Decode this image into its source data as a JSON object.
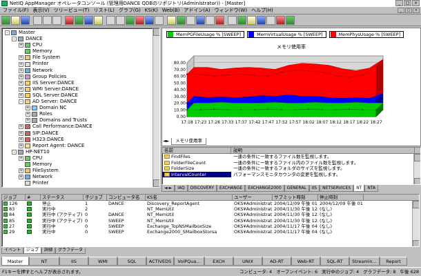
{
  "window": {
    "title": "NetIQ AppManager オペレータコンソール (管理用DANCE QDBのリポジトリ(Administrator)) - [Master]"
  },
  "menu": [
    "ファイル(F)",
    "表示(V)",
    "ツリービュー(T)",
    "リスト(L)",
    "グラフ(G)",
    "KS(K)",
    "Web(B)",
    "アドイン(A)",
    "ウィンドウ(W)",
    "ヘルプ(H)"
  ],
  "tree": [
    {
      "label": "Master",
      "level": 0,
      "expand": "-",
      "icon": "network-icon"
    },
    {
      "label": "DANCE",
      "level": 1,
      "expand": "-",
      "icon": "computer-icon"
    },
    {
      "label": "CPU",
      "level": 2,
      "expand": "+",
      "icon": "cpu-icon"
    },
    {
      "label": "Memory",
      "level": 2,
      "expand": "",
      "icon": "memory-icon"
    },
    {
      "label": "File System",
      "level": 2,
      "expand": "+",
      "icon": "folder-icon"
    },
    {
      "label": "Printer",
      "level": 2,
      "expand": "+",
      "icon": "printer-icon"
    },
    {
      "label": "Network",
      "level": 2,
      "expand": "+",
      "icon": "network-icon"
    },
    {
      "label": "Group Policies",
      "level": 2,
      "expand": "+",
      "icon": "policy-icon"
    },
    {
      "label": "IIS Server:DANCE",
      "level": 2,
      "expand": "+",
      "icon": "server-icon"
    },
    {
      "label": "WMI Server:DANCE",
      "level": 2,
      "expand": "+",
      "icon": "server-icon"
    },
    {
      "label": "SQL Server:DANCE",
      "level": 2,
      "expand": "+",
      "icon": "server-icon"
    },
    {
      "label": "AD Server: DANCE",
      "level": 2,
      "expand": "-",
      "icon": "server-icon"
    },
    {
      "label": "Domain NC",
      "level": 3,
      "expand": "+",
      "icon": "domain-icon"
    },
    {
      "label": "Roles",
      "level": 3,
      "expand": "+",
      "icon": "roles-icon"
    },
    {
      "label": "Domains and Trusts",
      "level": 3,
      "expand": "+",
      "icon": "trust-icon"
    },
    {
      "label": "Call Performance:DANCE",
      "level": 2,
      "expand": "+",
      "icon": "phone-icon"
    },
    {
      "label": "SIP:DANCE",
      "level": 2,
      "expand": "+",
      "icon": "phone-icon"
    },
    {
      "label": "H323:DANCE",
      "level": 2,
      "expand": "+",
      "icon": "phone-icon"
    },
    {
      "label": "Report Agent: DANCE",
      "level": 2,
      "expand": "+",
      "icon": "report-icon"
    },
    {
      "label": "HP-NET10",
      "level": 1,
      "expand": "-",
      "icon": "computer-icon"
    },
    {
      "label": "CPU",
      "level": 2,
      "expand": "+",
      "icon": "cpu-icon"
    },
    {
      "label": "Memory",
      "level": 2,
      "expand": "",
      "icon": "memory-icon"
    },
    {
      "label": "FileSystem",
      "level": 2,
      "expand": "+",
      "icon": "folder-icon"
    },
    {
      "label": "Network",
      "level": 2,
      "expand": "+",
      "icon": "network-icon"
    },
    {
      "label": "Printer",
      "level": 2,
      "expand": "",
      "icon": "printer-icon"
    }
  ],
  "chart_data": {
    "type": "area",
    "title": "メモリ使用率",
    "categories": [
      "17:18",
      "17:23",
      "17:28",
      "17:33",
      "17:37",
      "17:42",
      "17:47",
      "17:52",
      "17:57",
      "18:02",
      "18:07",
      "18:12",
      "18:17",
      "18:22",
      "18:27"
    ],
    "ylim": [
      0,
      80
    ],
    "yticks": [
      "0.00",
      "10.00",
      "20.00",
      "30.00",
      "40.00",
      "50.00",
      "60.00",
      "70.00",
      "80.00"
    ],
    "series": [
      {
        "name": "MemPGFileUsage % [SWEEP]",
        "color": "#00cc00",
        "values": [
          10,
          10,
          11,
          10,
          10,
          10,
          11,
          10,
          10,
          11,
          10,
          10,
          11,
          10,
          10
        ]
      },
      {
        "name": "MemVirtualUsage % [SWEEP]",
        "color": "#0000ff",
        "values": [
          20,
          18,
          19,
          18,
          19,
          21,
          20,
          22,
          20,
          20,
          18,
          17,
          18,
          17,
          24
        ]
      },
      {
        "name": "MemPhysUsage % [SWEEP]",
        "color": "#ff0000",
        "values": [
          63,
          63,
          60,
          62,
          63,
          62,
          60,
          66,
          69,
          68,
          66,
          61,
          58,
          62,
          75
        ]
      }
    ],
    "grid": true
  },
  "chart_tab": "メモリ使用率",
  "ks_list": {
    "columns": [
      "名前",
      "説明"
    ],
    "rows": [
      {
        "name": "FindFiles",
        "desc": "一連の条件に一致するファイル数を監視します。"
      },
      {
        "name": "FolderFileCount",
        "desc": "一連の条件に一致するファイル内のファイル数を監視します。"
      },
      {
        "name": "FolderSize",
        "desc": "一連の条件に一致するフォルダのサイズを監視します。"
      },
      {
        "name": "IntervalCounter",
        "desc": "パフォーマンスモニタカウンタの変更を監視します。"
      }
    ]
  },
  "ks_tabs": [
    "IAQ",
    "DISCOVERY",
    "EXCHANGE",
    "EXCHANGE2000",
    "GENERAL",
    "IIS",
    "NETSERVICES",
    "NT",
    "NTA"
  ],
  "jobs": {
    "columns": [
      "ジョブ",
      "#",
      "ステータス",
      "子ジョブ",
      "コンピュータ名",
      "KS名",
      "ユーザー",
      "サブミット時刻",
      "停止時刻"
    ],
    "rows": [
      {
        "id": "126",
        "status": "停止",
        "children": "1",
        "computer": "DANCE",
        "ks": "Discovery_ReportAgent",
        "user": "OKS¥Administrat",
        "submit": "2004/12/09 午後 01",
        "stop": "2004/12/09 午後 01"
      },
      {
        "id": "83",
        "status": "実行中",
        "children": "2",
        "computer": "",
        "ks": "NT_MemUtil",
        "user": "OKS¥Administrat",
        "submit": "2004/11/30 午後 12:54",
        "stop": "(なし)"
      },
      {
        "id": "84",
        "status": "実行中 (アクティブ)",
        "children": "0",
        "computer": "DANCE",
        "ks": "NT_MemUtil",
        "user": "OKS¥Administrat",
        "submit": "2004/11/30 午後 12:54",
        "stop": "(なし)"
      },
      {
        "id": "85",
        "status": "実行中 (アクティブ)",
        "children": "0",
        "computer": "SWEEP",
        "ks": "NT_MemUtil",
        "user": "OKS¥Administrat",
        "submit": "2004/11/30 午後 12:54",
        "stop": "(なし)"
      },
      {
        "id": "27",
        "status": "実行中",
        "children": "0",
        "computer": "SWEEP",
        "ks": "Exchange_TopNSMailboxSize",
        "user": "OKS¥Administrat",
        "submit": "2004/11/17 午後 04:58",
        "stop": "(なし)"
      },
      {
        "id": "29",
        "status": "実行中",
        "children": "0",
        "computer": "SWEEP",
        "ks": "Exchange2000_SMailboxStorsa",
        "user": "OKS¥Administrat",
        "submit": "2004/11/17 午後 04:58",
        "stop": "(なし)"
      }
    ]
  },
  "job_tabs": [
    "イベント",
    "ジョブ",
    "詳細",
    "グラフデータ"
  ],
  "bottom_tabs": [
    "Master",
    "NT",
    "IIS",
    "WMI",
    "SQL",
    "ACTIVEDS",
    "VoIPQua...",
    "EXCH",
    "UNIX",
    "AD-RT",
    "Web-RT",
    "SQL-RT",
    "Streamin...",
    "Report"
  ],
  "status": {
    "left": "F1キーを押すとヘルプが表示されます。",
    "computers": "コンピュータ: 4",
    "open_events": "オープンイベント: 6",
    "running_jobs": "実行中のジョブ: 4",
    "graph_data": "グラフデータ: 8",
    "time": "午後 628"
  }
}
